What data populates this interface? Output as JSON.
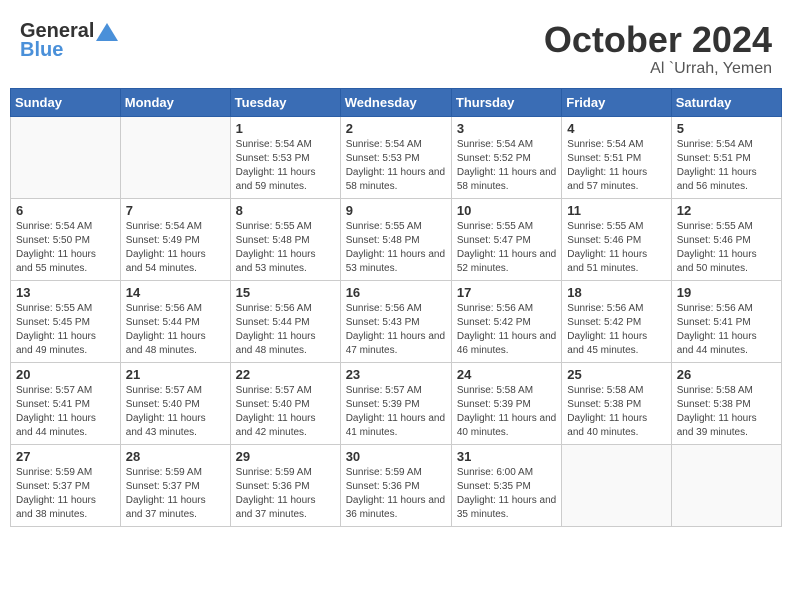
{
  "header": {
    "logo_general": "General",
    "logo_blue": "Blue",
    "month": "October 2024",
    "location": "Al `Urrah, Yemen"
  },
  "weekdays": [
    "Sunday",
    "Monday",
    "Tuesday",
    "Wednesday",
    "Thursday",
    "Friday",
    "Saturday"
  ],
  "weeks": [
    [
      {
        "day": "",
        "detail": ""
      },
      {
        "day": "",
        "detail": ""
      },
      {
        "day": "1",
        "detail": "Sunrise: 5:54 AM\nSunset: 5:53 PM\nDaylight: 11 hours and 59 minutes."
      },
      {
        "day": "2",
        "detail": "Sunrise: 5:54 AM\nSunset: 5:53 PM\nDaylight: 11 hours and 58 minutes."
      },
      {
        "day": "3",
        "detail": "Sunrise: 5:54 AM\nSunset: 5:52 PM\nDaylight: 11 hours and 58 minutes."
      },
      {
        "day": "4",
        "detail": "Sunrise: 5:54 AM\nSunset: 5:51 PM\nDaylight: 11 hours and 57 minutes."
      },
      {
        "day": "5",
        "detail": "Sunrise: 5:54 AM\nSunset: 5:51 PM\nDaylight: 11 hours and 56 minutes."
      }
    ],
    [
      {
        "day": "6",
        "detail": "Sunrise: 5:54 AM\nSunset: 5:50 PM\nDaylight: 11 hours and 55 minutes."
      },
      {
        "day": "7",
        "detail": "Sunrise: 5:54 AM\nSunset: 5:49 PM\nDaylight: 11 hours and 54 minutes."
      },
      {
        "day": "8",
        "detail": "Sunrise: 5:55 AM\nSunset: 5:48 PM\nDaylight: 11 hours and 53 minutes."
      },
      {
        "day": "9",
        "detail": "Sunrise: 5:55 AM\nSunset: 5:48 PM\nDaylight: 11 hours and 53 minutes."
      },
      {
        "day": "10",
        "detail": "Sunrise: 5:55 AM\nSunset: 5:47 PM\nDaylight: 11 hours and 52 minutes."
      },
      {
        "day": "11",
        "detail": "Sunrise: 5:55 AM\nSunset: 5:46 PM\nDaylight: 11 hours and 51 minutes."
      },
      {
        "day": "12",
        "detail": "Sunrise: 5:55 AM\nSunset: 5:46 PM\nDaylight: 11 hours and 50 minutes."
      }
    ],
    [
      {
        "day": "13",
        "detail": "Sunrise: 5:55 AM\nSunset: 5:45 PM\nDaylight: 11 hours and 49 minutes."
      },
      {
        "day": "14",
        "detail": "Sunrise: 5:56 AM\nSunset: 5:44 PM\nDaylight: 11 hours and 48 minutes."
      },
      {
        "day": "15",
        "detail": "Sunrise: 5:56 AM\nSunset: 5:44 PM\nDaylight: 11 hours and 48 minutes."
      },
      {
        "day": "16",
        "detail": "Sunrise: 5:56 AM\nSunset: 5:43 PM\nDaylight: 11 hours and 47 minutes."
      },
      {
        "day": "17",
        "detail": "Sunrise: 5:56 AM\nSunset: 5:42 PM\nDaylight: 11 hours and 46 minutes."
      },
      {
        "day": "18",
        "detail": "Sunrise: 5:56 AM\nSunset: 5:42 PM\nDaylight: 11 hours and 45 minutes."
      },
      {
        "day": "19",
        "detail": "Sunrise: 5:56 AM\nSunset: 5:41 PM\nDaylight: 11 hours and 44 minutes."
      }
    ],
    [
      {
        "day": "20",
        "detail": "Sunrise: 5:57 AM\nSunset: 5:41 PM\nDaylight: 11 hours and 44 minutes."
      },
      {
        "day": "21",
        "detail": "Sunrise: 5:57 AM\nSunset: 5:40 PM\nDaylight: 11 hours and 43 minutes."
      },
      {
        "day": "22",
        "detail": "Sunrise: 5:57 AM\nSunset: 5:40 PM\nDaylight: 11 hours and 42 minutes."
      },
      {
        "day": "23",
        "detail": "Sunrise: 5:57 AM\nSunset: 5:39 PM\nDaylight: 11 hours and 41 minutes."
      },
      {
        "day": "24",
        "detail": "Sunrise: 5:58 AM\nSunset: 5:39 PM\nDaylight: 11 hours and 40 minutes."
      },
      {
        "day": "25",
        "detail": "Sunrise: 5:58 AM\nSunset: 5:38 PM\nDaylight: 11 hours and 40 minutes."
      },
      {
        "day": "26",
        "detail": "Sunrise: 5:58 AM\nSunset: 5:38 PM\nDaylight: 11 hours and 39 minutes."
      }
    ],
    [
      {
        "day": "27",
        "detail": "Sunrise: 5:59 AM\nSunset: 5:37 PM\nDaylight: 11 hours and 38 minutes."
      },
      {
        "day": "28",
        "detail": "Sunrise: 5:59 AM\nSunset: 5:37 PM\nDaylight: 11 hours and 37 minutes."
      },
      {
        "day": "29",
        "detail": "Sunrise: 5:59 AM\nSunset: 5:36 PM\nDaylight: 11 hours and 37 minutes."
      },
      {
        "day": "30",
        "detail": "Sunrise: 5:59 AM\nSunset: 5:36 PM\nDaylight: 11 hours and 36 minutes."
      },
      {
        "day": "31",
        "detail": "Sunrise: 6:00 AM\nSunset: 5:35 PM\nDaylight: 11 hours and 35 minutes."
      },
      {
        "day": "",
        "detail": ""
      },
      {
        "day": "",
        "detail": ""
      }
    ]
  ]
}
